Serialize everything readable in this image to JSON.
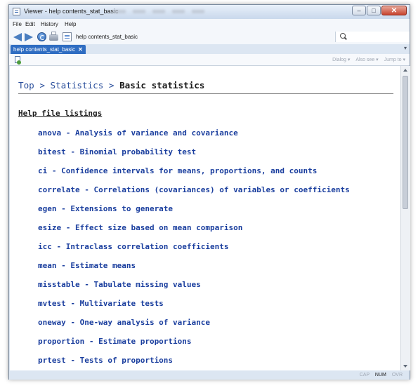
{
  "window": {
    "title": "Viewer - help contents_stat_basic",
    "controls": {
      "minimize": "–",
      "maximize": "□",
      "close": "✕"
    }
  },
  "menu": [
    "File",
    "Edit",
    "History",
    "Help"
  ],
  "toolbar": {
    "command": "help contents_stat_basic",
    "icons": [
      "back-arrow-icon",
      "forward-arrow-icon",
      "refresh-icon",
      "print-icon",
      "document-icon",
      "search-icon"
    ]
  },
  "tabs": [
    {
      "label": "help contents_stat_basic",
      "close": "✕"
    }
  ],
  "subtoolbar": {
    "dialog": "Dialog ▾",
    "also_see": "Also see ▾",
    "jump_to": "Jump to ▾"
  },
  "breadcrumb": {
    "top": "Top",
    "sep1": " > ",
    "statistics": "Statistics",
    "sep2": " > ",
    "current": "Basic statistics"
  },
  "section_title": "Help file listings",
  "listings": [
    "anova - Analysis of variance and covariance",
    "bitest - Binomial probability test",
    "ci - Confidence intervals for means, proportions, and counts",
    "correlate - Correlations (covariances) of variables or coefficients",
    "egen - Extensions to generate",
    "esize - Effect size based on mean comparison",
    "icc - Intraclass correlation coefficients",
    "mean - Estimate means",
    "misstable - Tabulate missing values",
    "mvtest - Multivariate tests",
    "oneway - One-way analysis of variance",
    "proportion - Estimate proportions",
    "prtest - Tests of proportions"
  ],
  "status": {
    "cap": "CAP",
    "num": "NUM",
    "ovr": "OVR"
  }
}
